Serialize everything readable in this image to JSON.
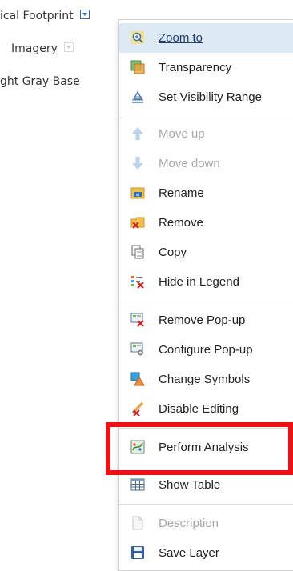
{
  "layers": [
    {
      "label": "ical Footprint",
      "arrow": "active"
    },
    {
      "label": "Imagery",
      "arrow": "dim"
    },
    {
      "label": "ght Gray Base",
      "arrow": "none"
    }
  ],
  "menu": {
    "items": [
      {
        "label": "Zoom to",
        "icon": "zoom-in-icon",
        "state": "hover"
      },
      {
        "label": "Transparency",
        "icon": "transparency-icon",
        "state": "enabled"
      },
      {
        "label": "Set Visibility Range",
        "icon": "visibility-range-icon",
        "state": "enabled"
      },
      {
        "label": "Move up",
        "icon": "arrow-up-icon",
        "state": "disabled"
      },
      {
        "label": "Move down",
        "icon": "arrow-down-icon",
        "state": "disabled"
      },
      {
        "label": "Rename",
        "icon": "rename-icon",
        "state": "enabled"
      },
      {
        "label": "Remove",
        "icon": "remove-icon",
        "state": "enabled"
      },
      {
        "label": "Copy",
        "icon": "copy-icon",
        "state": "enabled"
      },
      {
        "label": "Hide in Legend",
        "icon": "hide-legend-icon",
        "state": "enabled"
      },
      {
        "label": "Remove Pop-up",
        "icon": "remove-popup-icon",
        "state": "enabled"
      },
      {
        "label": "Configure Pop-up",
        "icon": "configure-popup-icon",
        "state": "enabled"
      },
      {
        "label": "Change Symbols",
        "icon": "change-symbols-icon",
        "state": "enabled"
      },
      {
        "label": "Disable Editing",
        "icon": "disable-editing-icon",
        "state": "enabled"
      },
      {
        "label": "Perform Analysis",
        "icon": "perform-analysis-icon",
        "state": "enabled"
      },
      {
        "label": "Show Table",
        "icon": "table-icon",
        "state": "enabled"
      },
      {
        "label": "Description",
        "icon": "description-icon",
        "state": "disabled"
      },
      {
        "label": "Save Layer",
        "icon": "save-icon",
        "state": "enabled"
      }
    ]
  },
  "colors": {
    "hover_bg": "#dde9f5",
    "highlight": "#ee1111",
    "disabled_text": "#a7a7a7"
  }
}
